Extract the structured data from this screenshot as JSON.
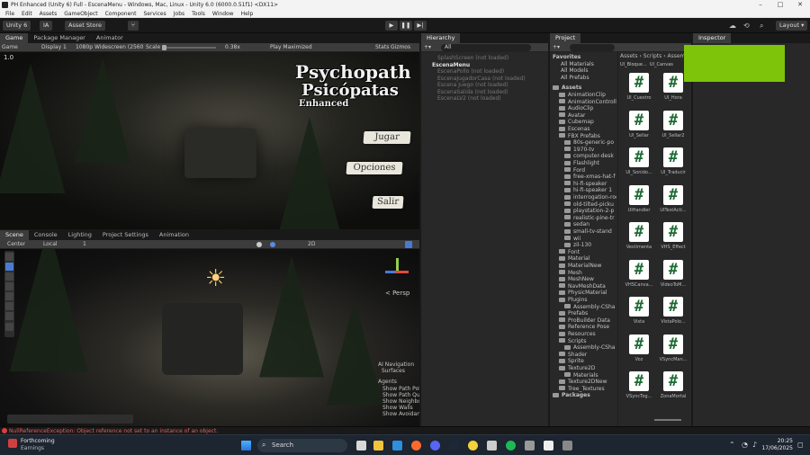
{
  "window": {
    "title": "PH Enhanced (Unity 6) Full - EscenaMenu - Windows, Mac, Linux - Unity 6.0 (6000.0.51f1) <DX11>"
  },
  "menu": [
    "File",
    "Edit",
    "Assets",
    "GameObject",
    "Component",
    "Services",
    "Jobs",
    "Tools",
    "Window",
    "Help"
  ],
  "toolbar": {
    "account": "Unity 6",
    "user": "IA",
    "asset_store": "Asset Store",
    "layout": "Layout"
  },
  "game_view": {
    "tabs": [
      "Game",
      "Package Manager",
      "Animator"
    ],
    "display": "Display 1",
    "resolution": "1080p Widescreen (2560",
    "scale_label": "Scale",
    "scale_value": "0.38x",
    "play_mode": "Play Maximized",
    "stats": "Stats",
    "gizmos": "Gizmos",
    "fps_label": "1.0",
    "title_line1": "Psychopath",
    "title_line2": "Psicópatas",
    "title_line3": "Enhanced",
    "btn_play": "Jugar",
    "btn_options": "Opciones",
    "btn_exit": "Salir"
  },
  "hierarchy": {
    "title": "Hierarchy",
    "search": "All",
    "items": [
      {
        "label": "SplashScreen (not loaded)",
        "dim": true
      },
      {
        "label": "EscenaMenu",
        "dim": false
      },
      {
        "label": "EscenaPollo (not loaded)",
        "dim": true
      },
      {
        "label": "EscenaJugadorCasa (not loaded)",
        "dim": true
      },
      {
        "label": "Escena Juego (not loaded)",
        "dim": true
      },
      {
        "label": "EscenaSalida (not loaded)",
        "dim": true
      },
      {
        "label": "EscenaLV2 (not loaded)",
        "dim": true
      }
    ]
  },
  "scene_view": {
    "tabs": [
      "Scene",
      "Console",
      "Lighting",
      "Project Settings",
      "Animation"
    ],
    "pivot": "Center",
    "space": "Local",
    "grid_value": "1",
    "render_2d": "2D",
    "persp": "< Persp",
    "overlay": {
      "nav_title": "AI Navigation",
      "surfaces": "Surfaces",
      "agents": "Agents",
      "items": [
        "Show Path Poly",
        "Show Path Quer",
        "Show Neighbo",
        "Show Walls",
        "Show Avoidanc"
      ]
    }
  },
  "project": {
    "title": "Project",
    "favorites_title": "Favorites",
    "favorites": [
      "All Materials",
      "All Models",
      "All Prefabs"
    ],
    "assets_title": "Assets",
    "tree": [
      {
        "label": "AnimationClip",
        "d": 1
      },
      {
        "label": "AnimationControlle",
        "d": 1
      },
      {
        "label": "AudioClip",
        "d": 1
      },
      {
        "label": "Avatar",
        "d": 1
      },
      {
        "label": "Cubemap",
        "d": 1
      },
      {
        "label": "Escenas",
        "d": 1
      },
      {
        "label": "FBX Prefabs",
        "d": 1
      },
      {
        "label": "80s-generic-po",
        "d": 2
      },
      {
        "label": "1970-tv",
        "d": 2
      },
      {
        "label": "computer-desk",
        "d": 2
      },
      {
        "label": "Flashlight",
        "d": 2
      },
      {
        "label": "Ford",
        "d": 2
      },
      {
        "label": "free-xmas-hat-f",
        "d": 2
      },
      {
        "label": "hi-fi-speaker",
        "d": 2
      },
      {
        "label": "hi-fi-speaker 1",
        "d": 2
      },
      {
        "label": "interrogation-roo",
        "d": 2
      },
      {
        "label": "old-tilted-picku",
        "d": 2
      },
      {
        "label": "playstation-2-p",
        "d": 2
      },
      {
        "label": "realistic-pine-tr",
        "d": 2
      },
      {
        "label": "sedan",
        "d": 2
      },
      {
        "label": "small-tv-stand",
        "d": 2
      },
      {
        "label": "wii",
        "d": 2
      },
      {
        "label": "zil-130",
        "d": 2
      },
      {
        "label": "Font",
        "d": 1
      },
      {
        "label": "Material",
        "d": 1
      },
      {
        "label": "MaterialNew",
        "d": 1
      },
      {
        "label": "Mesh",
        "d": 1
      },
      {
        "label": "MeshNew",
        "d": 1
      },
      {
        "label": "NavMeshData",
        "d": 1
      },
      {
        "label": "PhysicMaterial",
        "d": 1
      },
      {
        "label": "Plugins",
        "d": 1
      },
      {
        "label": "Assembly-CSha",
        "d": 2
      },
      {
        "label": "Prefabs",
        "d": 1
      },
      {
        "label": "ProBuilder Data",
        "d": 1
      },
      {
        "label": "Reference Pose",
        "d": 1
      },
      {
        "label": "Resources",
        "d": 1
      },
      {
        "label": "Scripts",
        "d": 1
      },
      {
        "label": "Assembly-CSha",
        "d": 2
      },
      {
        "label": "Shader",
        "d": 1
      },
      {
        "label": "Sprite",
        "d": 1
      },
      {
        "label": "Texture2D",
        "d": 1
      },
      {
        "label": "Materials",
        "d": 2
      },
      {
        "label": "Texture2DNew",
        "d": 1
      },
      {
        "label": "Tree_Textures",
        "d": 1
      }
    ],
    "packages_title": "Packages",
    "breadcrumb": [
      "Assets",
      "Scripts",
      "Assemb"
    ],
    "top_labels": [
      "UI_Bloque...",
      "UI_Canvas"
    ],
    "grid": [
      [
        "UI_Cuestro",
        "UI_Hora"
      ],
      [
        "UI_Sellar",
        "UI_Sellar2"
      ],
      [
        "UI_Sonido...",
        "UI_Traducir"
      ],
      [
        "UIHandler",
        "UITestActi..."
      ],
      [
        "Vestimenta",
        "VHS_Effect"
      ],
      [
        "VHSCanva...",
        "VideoToM..."
      ],
      [
        "Vista",
        "VistaPolo..."
      ],
      [
        "Voz",
        "VSyncMan..."
      ],
      [
        "VSyncTog...",
        "ZonaMortal"
      ]
    ]
  },
  "inspector": {
    "title": "Inspector"
  },
  "status": {
    "error": "NullReferenceException: Object reference not set to an instance of an object."
  },
  "taskbar": {
    "notif_title": "Forthcoming",
    "notif_sub": "Earnings",
    "search": "Search",
    "time": "20:25",
    "date": "17/06/2025"
  }
}
